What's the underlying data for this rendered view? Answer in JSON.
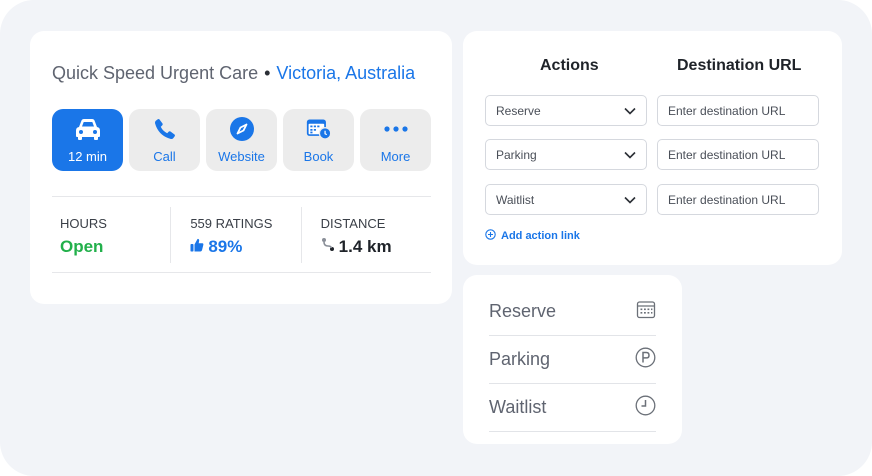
{
  "place": {
    "name": "Quick Speed Urgent Care",
    "separator": "•",
    "location": "Victoria, Australia"
  },
  "actions": [
    {
      "label": "12 min",
      "icon": "car-icon"
    },
    {
      "label": "Call",
      "icon": "phone-icon"
    },
    {
      "label": "Website",
      "icon": "compass-icon"
    },
    {
      "label": "Book",
      "icon": "calendar-clock-icon"
    },
    {
      "label": "More",
      "icon": "more-dots-icon"
    }
  ],
  "stats": {
    "hours": {
      "label": "HOURS",
      "value": "Open"
    },
    "ratings": {
      "label": "559 RATINGS",
      "value": "89%"
    },
    "distance": {
      "label": "DISTANCE",
      "value": "1.4 km"
    }
  },
  "action_links": {
    "actions_header": "Actions",
    "url_header": "Destination URL",
    "rows": [
      {
        "action": "Reserve",
        "url_placeholder": "Enter destination URL"
      },
      {
        "action": "Parking",
        "url_placeholder": "Enter destination URL"
      },
      {
        "action": "Waitlist",
        "url_placeholder": "Enter destination URL"
      }
    ],
    "add_label": "Add action link"
  },
  "preview_list": [
    {
      "label": "Reserve",
      "icon": "calendar-icon"
    },
    {
      "label": "Parking",
      "icon": "parking-icon"
    },
    {
      "label": "Waitlist",
      "icon": "clock-icon"
    }
  ],
  "colors": {
    "accent": "#1a76e8",
    "open": "#22b04b",
    "background": "#f2f4f8"
  }
}
